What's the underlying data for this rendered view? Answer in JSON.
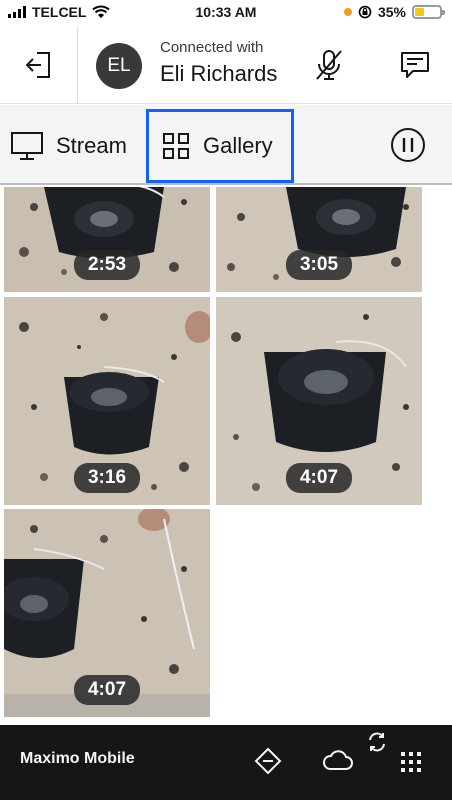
{
  "status_bar": {
    "carrier": "TELCEL",
    "time": "10:33 AM",
    "battery": "35%",
    "battery_level": 0.35,
    "icons": [
      "signal-icon",
      "wifi-icon",
      "location-icon",
      "screen-lock-icon",
      "battery-icon"
    ]
  },
  "header": {
    "avatar_initials": "EL",
    "connected_label": "Connected with",
    "connected_name": "Eli Richards",
    "icons": [
      "exit-icon",
      "mic-off-icon",
      "chat-icon"
    ]
  },
  "tabs": {
    "stream_label": "Stream",
    "gallery_label": "Gallery",
    "selected": "Gallery",
    "icons": [
      "monitor-icon",
      "grid-icon",
      "pause-icon"
    ]
  },
  "gallery": {
    "items": [
      {
        "duration": "2:53"
      },
      {
        "duration": "3:05"
      },
      {
        "duration": "3:16"
      },
      {
        "duration": "4:07"
      },
      {
        "duration": "4:07"
      }
    ]
  },
  "bottom_bar": {
    "app_name": "Maximo Mobile",
    "icons": [
      "navigation-icon",
      "cloud-icon",
      "sync-icon",
      "apps-grid-icon"
    ]
  },
  "colors": {
    "accent": "#0f62fe",
    "bottom_bar": "#161616",
    "tab_bg": "#f4f4f4",
    "badge": "#282828"
  }
}
